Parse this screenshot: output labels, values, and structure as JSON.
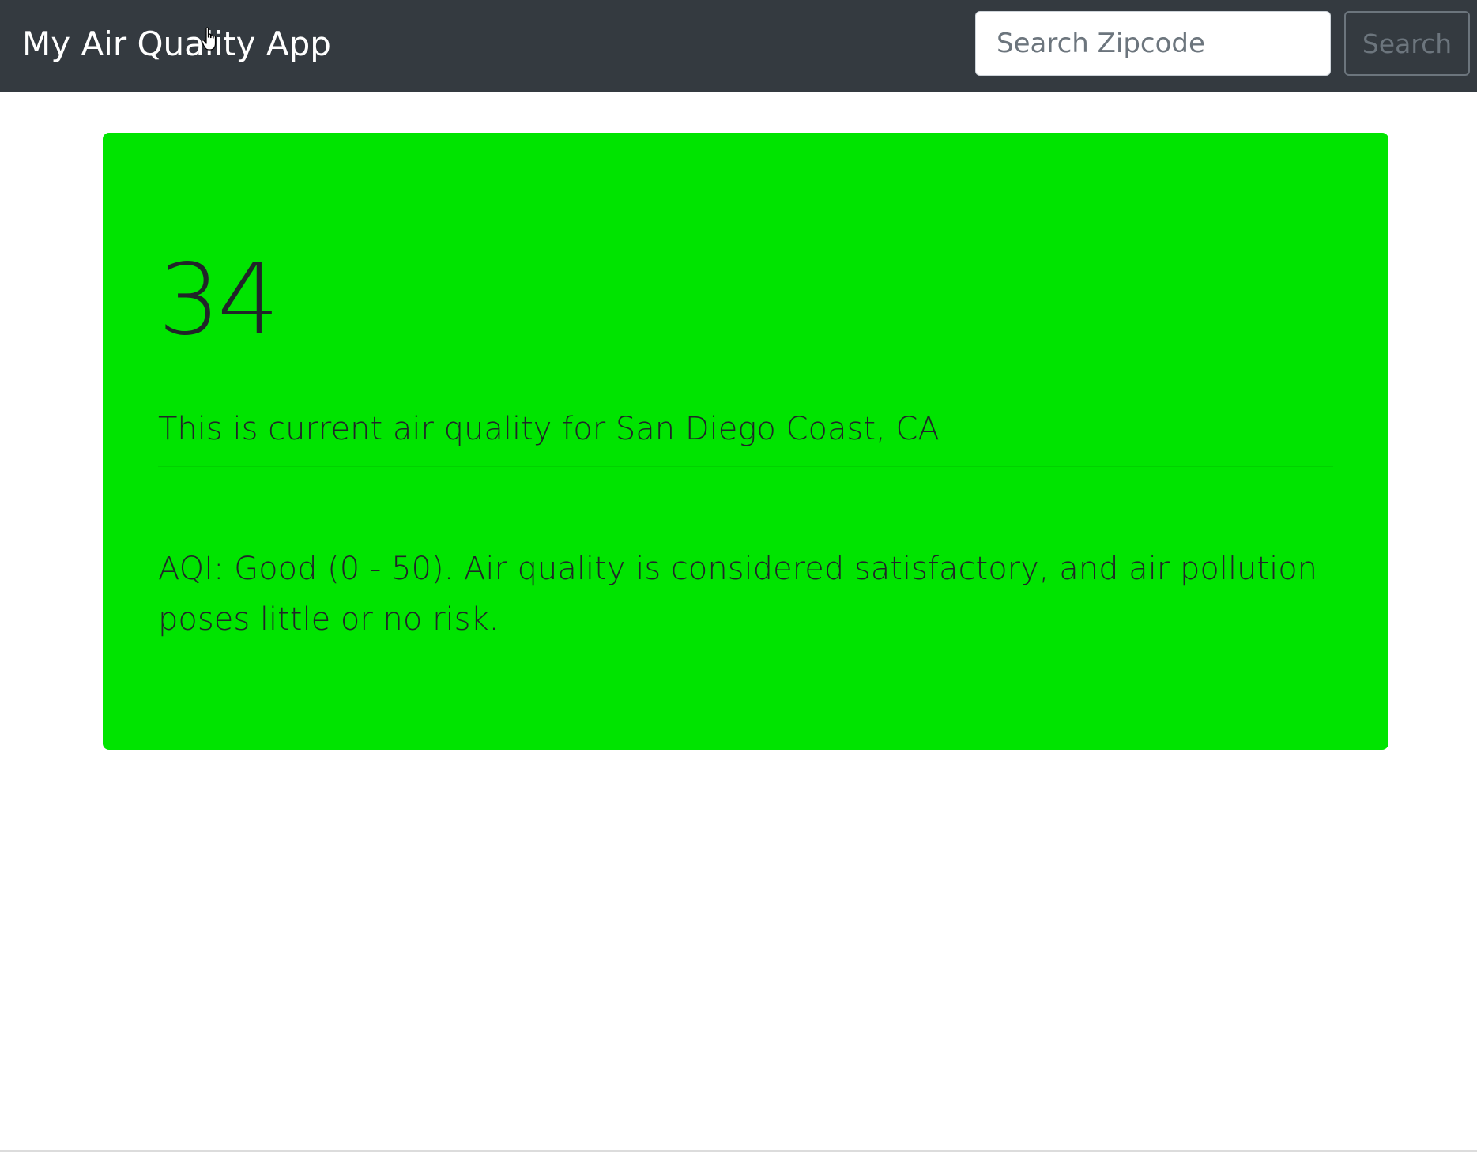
{
  "navbar": {
    "brand": "My Air Quality App",
    "search_placeholder": "Search Zipcode",
    "search_value": "",
    "search_button": "Search"
  },
  "result": {
    "aqi": "34",
    "location_text": "This is current air quality for San Diego Coast, CA",
    "description": "AQI: Good (0 - 50). Air quality is considered satisfactory, and air pollution poses little or no risk.",
    "category_color": "#00e400"
  },
  "colors": {
    "navbar_bg": "#343a40",
    "text_dark": "#212529"
  },
  "icons": {
    "cursor": "hand-pointer-icon"
  }
}
